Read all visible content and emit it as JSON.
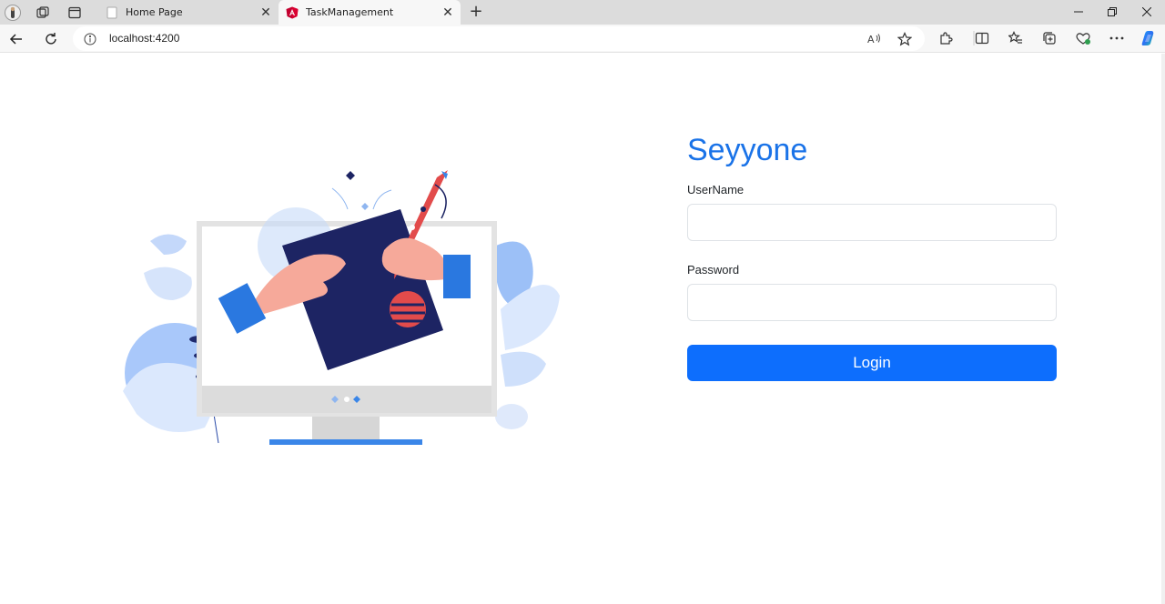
{
  "browser": {
    "tabs": [
      {
        "title": "Home Page",
        "active": false
      },
      {
        "title": "TaskManagement",
        "active": true
      }
    ],
    "address": "localhost:4200"
  },
  "page": {
    "brand": "Seyyone",
    "username_label": "UserName",
    "password_label": "Password",
    "username_value": "",
    "password_value": "",
    "login_button": "Login",
    "accent_color": "#1a73e8",
    "button_color": "#0d6efd"
  }
}
